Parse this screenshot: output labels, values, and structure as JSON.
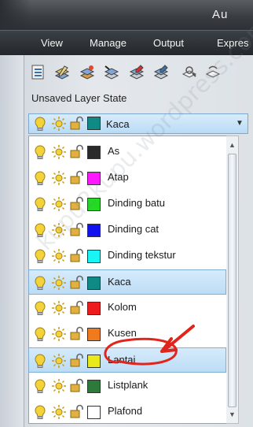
{
  "title_bar": {
    "text": "Au"
  },
  "menu": [
    "View",
    "Manage",
    "Output",
    "Expres"
  ],
  "toolbar": {
    "tools": [
      "layer-properties-icon",
      "set-current-icon",
      "layer-states-icon",
      "layer-match-icon",
      "layer-isolate-icon",
      "layer-unisolate-icon",
      "layer-freeze-icon",
      "layer-off-icon"
    ]
  },
  "layer_state_label": "Unsaved Layer State",
  "current_layer": {
    "name": "Kaca",
    "color": "#0f8a85"
  },
  "layers": [
    {
      "name": "As",
      "color": "#2a2a2a",
      "selected": false,
      "circled": false
    },
    {
      "name": "Atap",
      "color": "#ff17ff",
      "selected": false,
      "circled": false
    },
    {
      "name": "Dinding batu",
      "color": "#21dc21",
      "selected": false,
      "circled": false
    },
    {
      "name": "Dinding cat",
      "color": "#1212f0",
      "selected": false,
      "circled": false
    },
    {
      "name": "Dinding tekstur",
      "color": "#19f4f4",
      "selected": false,
      "circled": false
    },
    {
      "name": "Kaca",
      "color": "#0f8a85",
      "selected": true,
      "circled": false
    },
    {
      "name": "Kolom",
      "color": "#ee1c1c",
      "selected": false,
      "circled": false
    },
    {
      "name": "Kusen",
      "color": "#f07a1c",
      "selected": false,
      "circled": false
    },
    {
      "name": "Lantai",
      "color": "#e8e81a",
      "selected": true,
      "circled": true
    },
    {
      "name": "Listplank",
      "color": "#2e7a3a",
      "selected": false,
      "circled": false
    },
    {
      "name": "Plafond",
      "color": "#ffffff",
      "selected": false,
      "circled": false
    }
  ],
  "colors": {
    "bulb": "#f4d23a",
    "sun": "#e8b81e",
    "lock": "#d8a22c",
    "annotation": "#e0251c",
    "selection": "#bcdcf5"
  }
}
